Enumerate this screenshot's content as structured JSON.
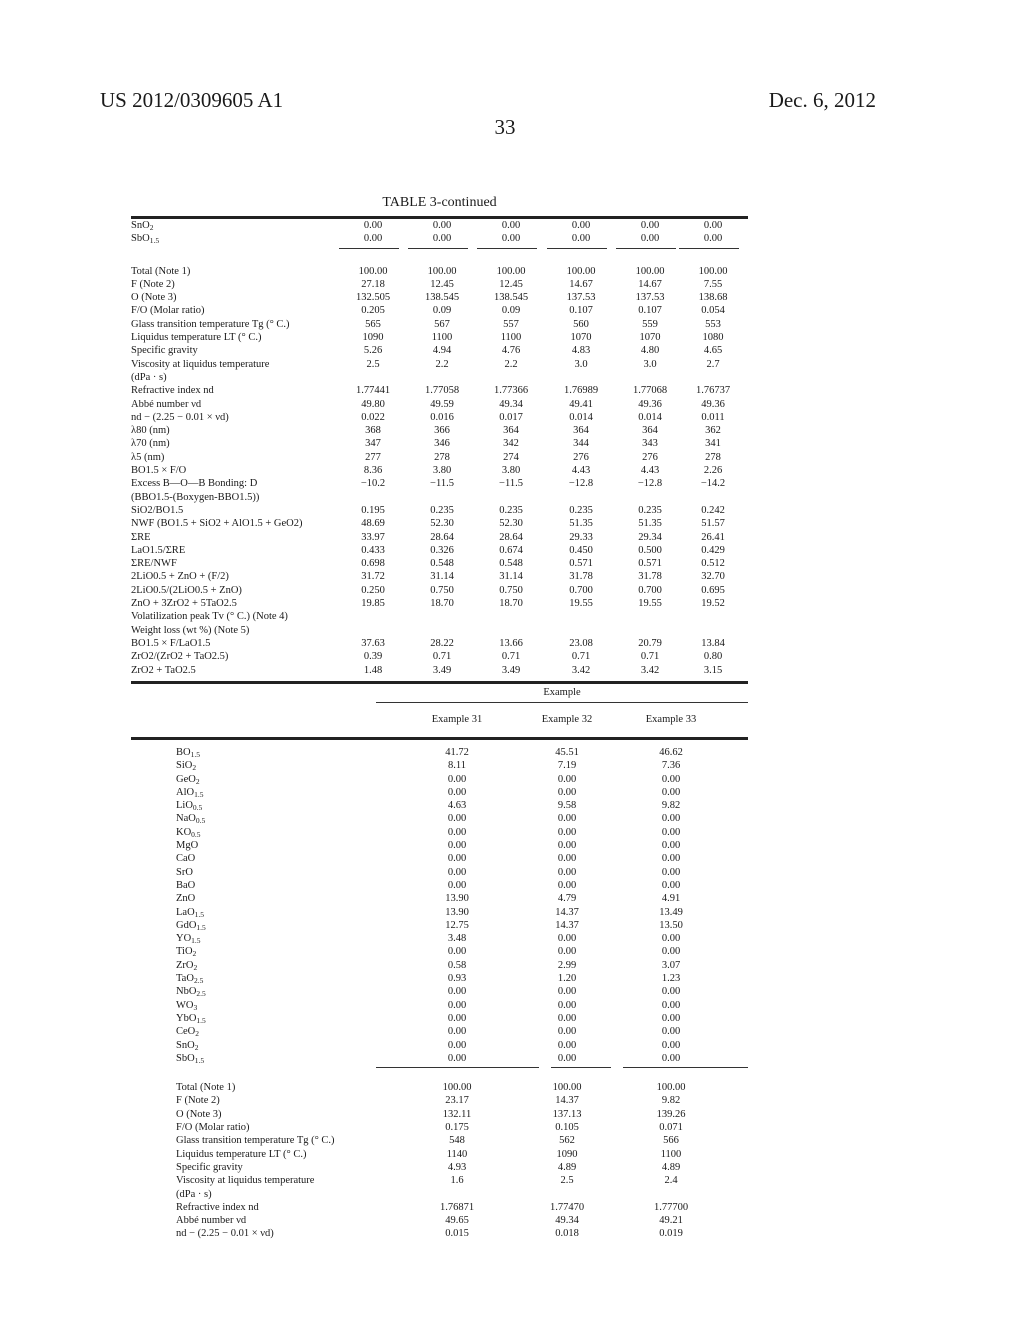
{
  "header": {
    "patent_number": "US 2012/0309605 A1",
    "date": "Dec. 6, 2012",
    "page_number": "33"
  },
  "table_title": "TABLE 3-continued",
  "table1": {
    "oxide_rows": [
      {
        "label": "SnO",
        "sub": "2",
        "values": [
          "0.00",
          "0.00",
          "0.00",
          "0.00",
          "0.00",
          "0.00"
        ]
      },
      {
        "label": "SbO",
        "sub": "1.5",
        "values": [
          "0.00",
          "0.00",
          "0.00",
          "0.00",
          "0.00",
          "0.00"
        ]
      }
    ],
    "property_rows": [
      {
        "label": "Total (Note 1)",
        "values": [
          "100.00",
          "100.00",
          "100.00",
          "100.00",
          "100.00",
          "100.00"
        ]
      },
      {
        "label": "F (Note 2)",
        "values": [
          "27.18",
          "12.45",
          "12.45",
          "14.67",
          "14.67",
          "7.55"
        ]
      },
      {
        "label": "O (Note 3)",
        "values": [
          "132.505",
          "138.545",
          "138.545",
          "137.53",
          "137.53",
          "138.68"
        ]
      },
      {
        "label": "F/O (Molar ratio)",
        "values": [
          "0.205",
          "0.09",
          "0.09",
          "0.107",
          "0.107",
          "0.054"
        ]
      },
      {
        "label": "Glass transition temperature Tg (° C.)",
        "values": [
          "565",
          "567",
          "557",
          "560",
          "559",
          "553"
        ]
      },
      {
        "label": "Liquidus temperature LT (° C.)",
        "values": [
          "1090",
          "1100",
          "1100",
          "1070",
          "1070",
          "1080"
        ]
      },
      {
        "label": "Specific gravity",
        "values": [
          "5.26",
          "4.94",
          "4.76",
          "4.83",
          "4.80",
          "4.65"
        ]
      },
      {
        "label": "Viscosity at liquidus temperature",
        "values": [
          "2.5",
          "2.2",
          "2.2",
          "3.0",
          "3.0",
          "2.7"
        ]
      },
      {
        "label": "(dPa · s)",
        "values": [
          "",
          "",
          "",
          "",
          "",
          ""
        ]
      },
      {
        "label": "Refractive index nd",
        "values": [
          "1.77441",
          "1.77058",
          "1.77366",
          "1.76989",
          "1.77068",
          "1.76737"
        ]
      },
      {
        "label": "Abbé number νd",
        "values": [
          "49.80",
          "49.59",
          "49.34",
          "49.41",
          "49.36",
          "49.36"
        ]
      },
      {
        "label": "nd − (2.25 − 0.01 × νd)",
        "values": [
          "0.022",
          "0.016",
          "0.017",
          "0.014",
          "0.014",
          "0.011"
        ]
      },
      {
        "label": "λ80 (nm)",
        "values": [
          "368",
          "366",
          "364",
          "364",
          "364",
          "362"
        ]
      },
      {
        "label": "λ70 (nm)",
        "values": [
          "347",
          "346",
          "342",
          "344",
          "343",
          "341"
        ]
      },
      {
        "label": "λ5 (nm)",
        "values": [
          "277",
          "278",
          "274",
          "276",
          "276",
          "278"
        ]
      },
      {
        "label": "BO1.5 × F/O",
        "values": [
          "8.36",
          "3.80",
          "3.80",
          "4.43",
          "4.43",
          "2.26"
        ]
      },
      {
        "label": "Excess B—O—B Bonding: D",
        "values": [
          "−10.2",
          "−11.5",
          "−11.5",
          "−12.8",
          "−12.8",
          "−14.2"
        ]
      },
      {
        "label": "(BBO1.5-(Boxygen-BBO1.5))",
        "values": [
          "",
          "",
          "",
          "",
          "",
          ""
        ]
      },
      {
        "label": "SiO2/BO1.5",
        "values": [
          "0.195",
          "0.235",
          "0.235",
          "0.235",
          "0.235",
          "0.242"
        ]
      },
      {
        "label": "NWF (BO1.5 + SiO2 + AlO1.5 + GeO2)",
        "values": [
          "48.69",
          "52.30",
          "52.30",
          "51.35",
          "51.35",
          "51.57"
        ]
      },
      {
        "label": "ΣRE",
        "values": [
          "33.97",
          "28.64",
          "28.64",
          "29.33",
          "29.34",
          "26.41"
        ]
      },
      {
        "label": "LaO1.5/ΣRE",
        "values": [
          "0.433",
          "0.326",
          "0.674",
          "0.450",
          "0.500",
          "0.429"
        ]
      },
      {
        "label": "ΣRE/NWF",
        "values": [
          "0.698",
          "0.548",
          "0.548",
          "0.571",
          "0.571",
          "0.512"
        ]
      },
      {
        "label": "2LiO0.5 + ZnO + (F/2)",
        "values": [
          "31.72",
          "31.14",
          "31.14",
          "31.78",
          "31.78",
          "32.70"
        ]
      },
      {
        "label": "2LiO0.5/(2LiO0.5 + ZnO)",
        "values": [
          "0.250",
          "0.750",
          "0.750",
          "0.700",
          "0.700",
          "0.695"
        ]
      },
      {
        "label": "ZnO + 3ZrO2 + 5TaO2.5",
        "values": [
          "19.85",
          "18.70",
          "18.70",
          "19.55",
          "19.55",
          "19.52"
        ]
      },
      {
        "label": "Volatilization peak Tv (° C.) (Note 4)",
        "values": [
          "",
          "",
          "",
          "",
          "",
          ""
        ]
      },
      {
        "label": "Weight loss (wt %) (Note 5)",
        "values": [
          "",
          "",
          "",
          "",
          "",
          ""
        ]
      },
      {
        "label": "BO1.5 × F/LaO1.5",
        "values": [
          "37.63",
          "28.22",
          "13.66",
          "23.08",
          "20.79",
          "13.84"
        ]
      },
      {
        "label": "ZrO2/(ZrO2 + TaO2.5)",
        "values": [
          "0.39",
          "0.71",
          "0.71",
          "0.71",
          "0.71",
          "0.80"
        ]
      },
      {
        "label": "ZrO2 + TaO2.5",
        "values": [
          "1.48",
          "3.49",
          "3.49",
          "3.42",
          "3.42",
          "3.15"
        ]
      }
    ]
  },
  "table2": {
    "group_header": "Example",
    "columns": [
      "Example 31",
      "Example 32",
      "Example 33"
    ],
    "oxide_rows": [
      {
        "label": "BO",
        "sub": "1.5",
        "values": [
          "41.72",
          "45.51",
          "46.62"
        ]
      },
      {
        "label": "SiO",
        "sub": "2",
        "values": [
          "8.11",
          "7.19",
          "7.36"
        ]
      },
      {
        "label": "GeO",
        "sub": "2",
        "values": [
          "0.00",
          "0.00",
          "0.00"
        ]
      },
      {
        "label": "AlO",
        "sub": "1.5",
        "values": [
          "0.00",
          "0.00",
          "0.00"
        ]
      },
      {
        "label": "LiO",
        "sub": "0.5",
        "values": [
          "4.63",
          "9.58",
          "9.82"
        ]
      },
      {
        "label": "NaO",
        "sub": "0.5",
        "values": [
          "0.00",
          "0.00",
          "0.00"
        ]
      },
      {
        "label": "KO",
        "sub": "0.5",
        "values": [
          "0.00",
          "0.00",
          "0.00"
        ]
      },
      {
        "label": "MgO",
        "sub": "",
        "values": [
          "0.00",
          "0.00",
          "0.00"
        ]
      },
      {
        "label": "CaO",
        "sub": "",
        "values": [
          "0.00",
          "0.00",
          "0.00"
        ]
      },
      {
        "label": "SrO",
        "sub": "",
        "values": [
          "0.00",
          "0.00",
          "0.00"
        ]
      },
      {
        "label": "BaO",
        "sub": "",
        "values": [
          "0.00",
          "0.00",
          "0.00"
        ]
      },
      {
        "label": "ZnO",
        "sub": "",
        "values": [
          "13.90",
          "4.79",
          "4.91"
        ]
      },
      {
        "label": "LaO",
        "sub": "1.5",
        "values": [
          "13.90",
          "14.37",
          "13.49"
        ]
      },
      {
        "label": "GdO",
        "sub": "1.5",
        "values": [
          "12.75",
          "14.37",
          "13.50"
        ]
      },
      {
        "label": "YO",
        "sub": "1.5",
        "values": [
          "3.48",
          "0.00",
          "0.00"
        ]
      },
      {
        "label": "TiO",
        "sub": "2",
        "values": [
          "0.00",
          "0.00",
          "0.00"
        ]
      },
      {
        "label": "ZrO",
        "sub": "2",
        "values": [
          "0.58",
          "2.99",
          "3.07"
        ]
      },
      {
        "label": "TaO",
        "sub": "2.5",
        "values": [
          "0.93",
          "1.20",
          "1.23"
        ]
      },
      {
        "label": "NbO",
        "sub": "2.5",
        "values": [
          "0.00",
          "0.00",
          "0.00"
        ]
      },
      {
        "label": "WO",
        "sub": "3",
        "values": [
          "0.00",
          "0.00",
          "0.00"
        ]
      },
      {
        "label": "YbO",
        "sub": "1.5",
        "values": [
          "0.00",
          "0.00",
          "0.00"
        ]
      },
      {
        "label": "CeO",
        "sub": "2",
        "values": [
          "0.00",
          "0.00",
          "0.00"
        ]
      },
      {
        "label": "SnO",
        "sub": "2",
        "values": [
          "0.00",
          "0.00",
          "0.00"
        ]
      },
      {
        "label": "SbO",
        "sub": "1.5",
        "values": [
          "0.00",
          "0.00",
          "0.00"
        ]
      }
    ],
    "property_rows": [
      {
        "label": "Total (Note 1)",
        "values": [
          "100.00",
          "100.00",
          "100.00"
        ]
      },
      {
        "label": "F (Note 2)",
        "values": [
          "23.17",
          "14.37",
          "9.82"
        ]
      },
      {
        "label": "O (Note 3)",
        "values": [
          "132.11",
          "137.13",
          "139.26"
        ]
      },
      {
        "label": "F/O (Molar ratio)",
        "values": [
          "0.175",
          "0.105",
          "0.071"
        ]
      },
      {
        "label": "Glass transition temperature Tg (° C.)",
        "values": [
          "548",
          "562",
          "566"
        ]
      },
      {
        "label": "Liquidus temperature LT (° C.)",
        "values": [
          "1140",
          "1090",
          "1100"
        ]
      },
      {
        "label": "Specific gravity",
        "values": [
          "4.93",
          "4.89",
          "4.89"
        ]
      },
      {
        "label": "Viscosity at liquidus temperature",
        "values": [
          "1.6",
          "2.5",
          "2.4"
        ]
      },
      {
        "label": "(dPa · s)",
        "values": [
          "",
          "",
          ""
        ]
      },
      {
        "label": "Refractive index nd",
        "values": [
          "1.76871",
          "1.77470",
          "1.77700"
        ]
      },
      {
        "label": "Abbé number νd",
        "values": [
          "49.65",
          "49.34",
          "49.21"
        ]
      },
      {
        "label": "nd − (2.25 − 0.01 × νd)",
        "values": [
          "0.015",
          "0.018",
          "0.019"
        ]
      }
    ]
  }
}
